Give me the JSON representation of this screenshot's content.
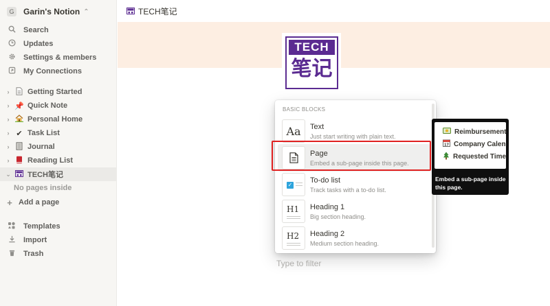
{
  "workspace": {
    "avatar": "G",
    "name": "Garin's Notion",
    "chevron_icon": "chevron-up-down-icon"
  },
  "nav": [
    {
      "id": "search",
      "icon": "search-icon",
      "label": "Search"
    },
    {
      "id": "updates",
      "icon": "clock-icon",
      "label": "Updates"
    },
    {
      "id": "settings",
      "icon": "gear-icon",
      "label": "Settings & members"
    },
    {
      "id": "connections",
      "icon": "arrow-box-icon",
      "label": "My Connections"
    }
  ],
  "pages": [
    {
      "id": "getting-started",
      "icon": "document-icon",
      "label": "Getting Started"
    },
    {
      "id": "quick-note",
      "icon": "pushpin-icon",
      "label": "Quick Note"
    },
    {
      "id": "personal-home",
      "icon": "house-icon",
      "label": "Personal Home"
    },
    {
      "id": "task-list",
      "icon": "checkmark-icon",
      "label": "Task List"
    },
    {
      "id": "journal",
      "icon": "notebook-icon",
      "label": "Journal"
    },
    {
      "id": "reading-list",
      "icon": "book-icon",
      "label": "Reading List"
    },
    {
      "id": "tech",
      "icon": "tech-logo-icon",
      "label": "TECH笔记",
      "active": true
    }
  ],
  "no_pages": "No pages inside",
  "add_page": "Add a page",
  "footer_nav": [
    {
      "id": "templates",
      "icon": "templates-icon",
      "label": "Templates"
    },
    {
      "id": "import",
      "icon": "download-icon",
      "label": "Import"
    },
    {
      "id": "trash",
      "icon": "trash-icon",
      "label": "Trash"
    }
  ],
  "breadcrumb": {
    "title": "TECH笔记"
  },
  "page_icon": {
    "top": "TECH",
    "bottom": "笔记",
    "colors": {
      "purple": "#5b2b91"
    }
  },
  "cover": {
    "color": "#fdeee2"
  },
  "menu": {
    "heading": "BASIC BLOCKS",
    "items": [
      {
        "id": "text",
        "title": "Text",
        "desc": "Just start writing with plain text.",
        "thumb": "Aa"
      },
      {
        "id": "page",
        "title": "Page",
        "desc": "Embed a sub-page inside this page.",
        "thumb": "page-icon",
        "highlighted": true
      },
      {
        "id": "todo",
        "title": "To-do list",
        "desc": "Track tasks with a to-do list.",
        "thumb": "checkbox-icon"
      },
      {
        "id": "h1",
        "title": "Heading 1",
        "desc": "Big section heading.",
        "thumb": "H1"
      },
      {
        "id": "h2",
        "title": "Heading 2",
        "desc": "Medium section heading.",
        "thumb": "H2"
      }
    ]
  },
  "preview": {
    "items": [
      {
        "icon": "money-icon",
        "label": "Reimbursement"
      },
      {
        "icon": "calendar-icon",
        "label": "Company Calendar"
      },
      {
        "icon": "tree-icon",
        "label": "Requested Time Off"
      }
    ],
    "caption": "Embed a sub-page inside this page."
  },
  "filter": {
    "placeholder": "Type to filter"
  },
  "colors": {
    "highlight_box": "#e02020",
    "sidebar_bg": "#f7f6f3"
  }
}
